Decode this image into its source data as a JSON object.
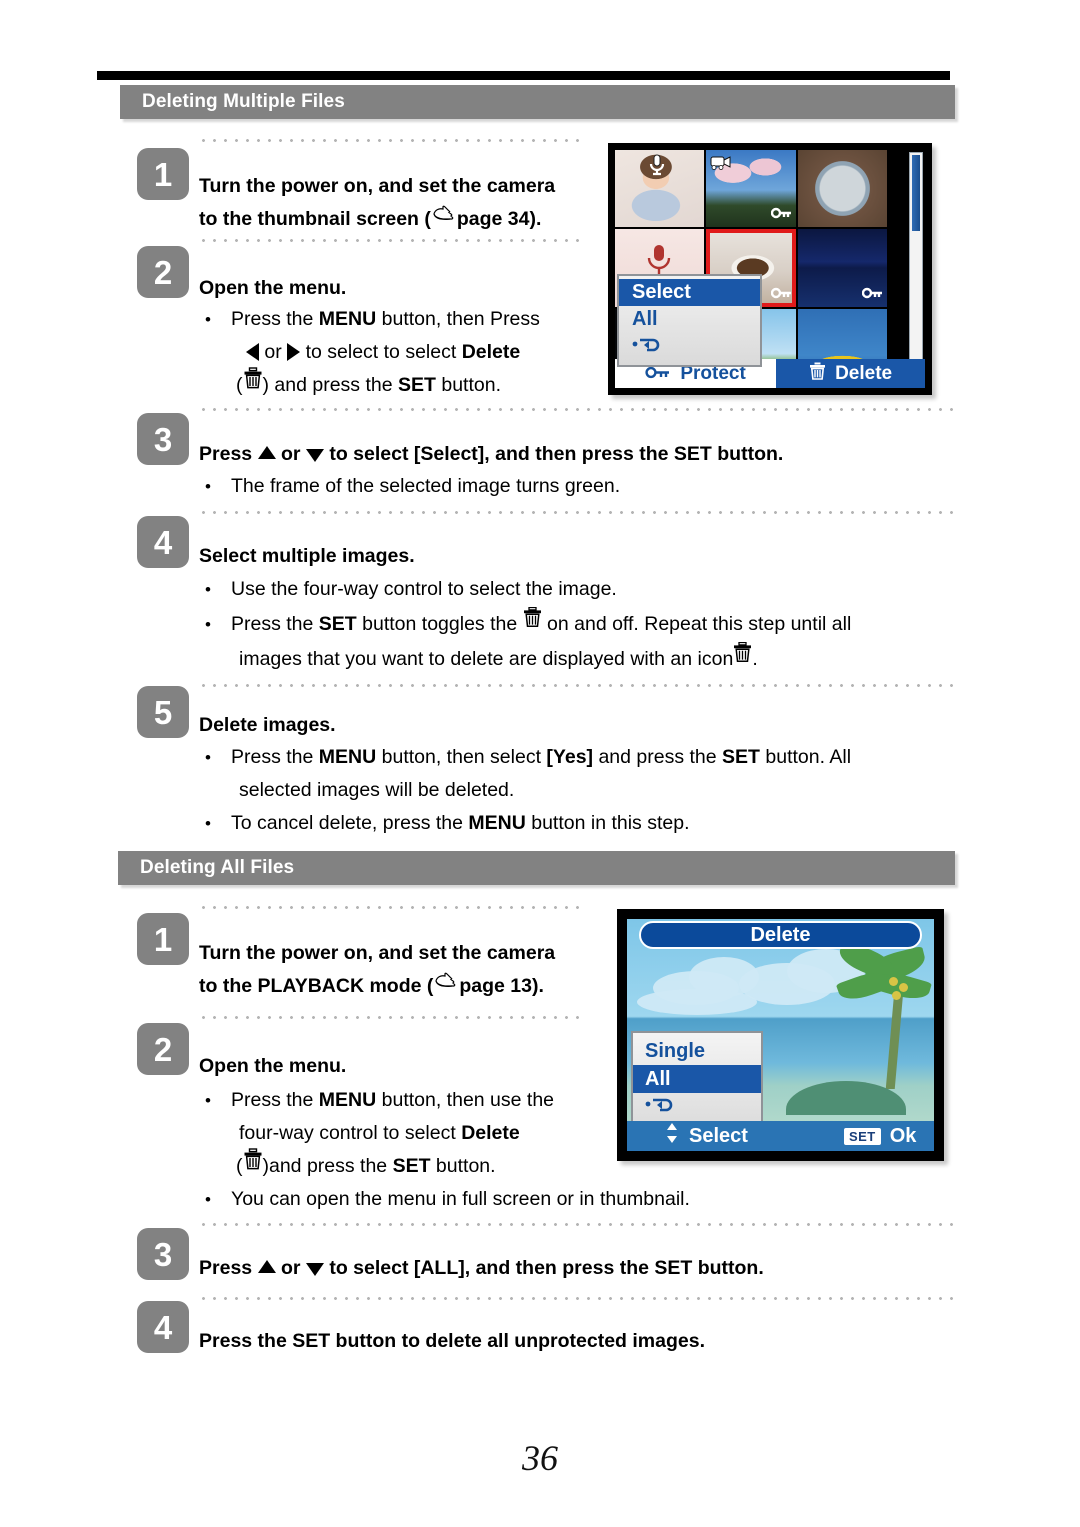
{
  "page": {
    "number": "36"
  },
  "sections": [
    {
      "title": "Deleting Multiple Files",
      "steps": [
        {
          "num": "1",
          "heading_line1": "Turn the power on, and set the camera",
          "heading_line2_pre": "to the thumbnail screen (",
          "heading_line2_post": "page 34)."
        },
        {
          "num": "2",
          "heading": "Open the menu.",
          "bullet1_a": "Press the ",
          "bullet1_menu": "MENU",
          "bullet1_b": " button, then Press",
          "bullet2_a": " or ",
          "bullet2_b": " to select to select ",
          "bullet2_delete": "Delete",
          "bullet3_a": "( ) and press the ",
          "bullet3_set": "SET",
          "bullet3_b": " button."
        },
        {
          "num": "3",
          "heading_a": "Press ",
          "heading_b": " or ",
          "heading_c": " to select [Select], and then press the SET button.",
          "bullet1": "The frame of the selected image turns green."
        },
        {
          "num": "4",
          "heading": "Select multiple images.",
          "bullet1": "Use the four-way control to select the image.",
          "bullet2_a": "Press the ",
          "bullet2_set": "SET",
          "bullet2_b": " button toggles the ",
          "bullet2_c": " on and off.   Repeat this step until all",
          "bullet2_line2_a": "images that you want to delete are displayed with an icon",
          "bullet2_line2_b": "."
        },
        {
          "num": "5",
          "heading": "Delete images.",
          "bullet1_a": "Press the ",
          "bullet1_menu": "MENU",
          "bullet1_b": " button, then select ",
          "bullet1_yes": "[Yes]",
          "bullet1_c": " and press the ",
          "bullet1_set": "SET",
          "bullet1_d": " button. All",
          "bullet1_line2": "selected images will be deleted.",
          "bullet2_a": "To cancel delete, press the ",
          "bullet2_menu": "MENU",
          "bullet2_b": " button in this step."
        }
      ]
    },
    {
      "title": "Deleting All Files",
      "steps": [
        {
          "num": "1",
          "heading_line1": "Turn the power on, and set the camera",
          "heading_line2_pre": "to the PLAYBACK mode (",
          "heading_line2_post": "page 13)."
        },
        {
          "num": "2",
          "heading": "Open the menu.",
          "bullet1_a": "Press the ",
          "bullet1_menu": "MENU",
          "bullet1_b": " button, then use the",
          "bullet1_line2_a": "four-way control to select ",
          "bullet1_delete": "Delete",
          "bullet1_line3_a": "( )and press the ",
          "bullet1_set": "SET",
          "bullet1_line3_b": " button.",
          "bullet2": "You can open the menu in full screen or in thumbnail."
        },
        {
          "num": "3",
          "heading_a": "Press ",
          "heading_b": " or ",
          "heading_c": " to select [ALL], and then press the SET button."
        },
        {
          "num": "4",
          "heading": "Press the SET button to delete all unprotected images."
        }
      ]
    }
  ],
  "lcd_thumbnail_screen": {
    "popup_menu": {
      "items": [
        {
          "label": "Select",
          "selected": true
        },
        {
          "label": "All",
          "selected": false
        },
        {
          "label": "",
          "selected": false,
          "icon": "back-arrow-icon"
        }
      ]
    },
    "bottom_bar": {
      "protect_label": "Protect",
      "protect_icon": "key-icon",
      "delete_label": "Delete",
      "delete_icon": "trash-icon",
      "delete_highlighted": true
    },
    "thumbnails": [
      {
        "name": "baby-photo",
        "badge": "microphone-icon",
        "protected": false
      },
      {
        "name": "cherry-blossom-photo",
        "badge": "video-icon",
        "protected": true
      },
      {
        "name": "two-girls-portrait-photo",
        "badge": "",
        "protected": false
      },
      {
        "name": "voice-memo-file",
        "badge": "",
        "protected": false
      },
      {
        "name": "coffee-cup-photo",
        "badge": "",
        "protected": true,
        "selected": true
      },
      {
        "name": "city-night-photo",
        "badge": "",
        "protected": true
      },
      {
        "name": "kite-flying-photo",
        "badge": "",
        "protected": false
      },
      {
        "name": "banana-boat-photo",
        "badge": "",
        "protected": false
      },
      {
        "name": "empty-slot",
        "badge": "",
        "protected": false
      }
    ]
  },
  "lcd_delete_screen": {
    "title": "Delete",
    "menu": {
      "items": [
        {
          "label": "Single",
          "selected": false
        },
        {
          "label": "All",
          "selected": true
        },
        {
          "label": "",
          "selected": false,
          "icon": "back-arrow-icon"
        }
      ]
    },
    "bottom_bar": {
      "select_label": "Select",
      "select_icon": "up-down-arrows-icon",
      "ok_chip": "SET",
      "ok_label": "Ok"
    }
  },
  "colors": {
    "header_gray": "#828282",
    "menu_blue": "#1a57a8",
    "text_blue": "#15519c",
    "selection_red": "#e01b1b"
  }
}
